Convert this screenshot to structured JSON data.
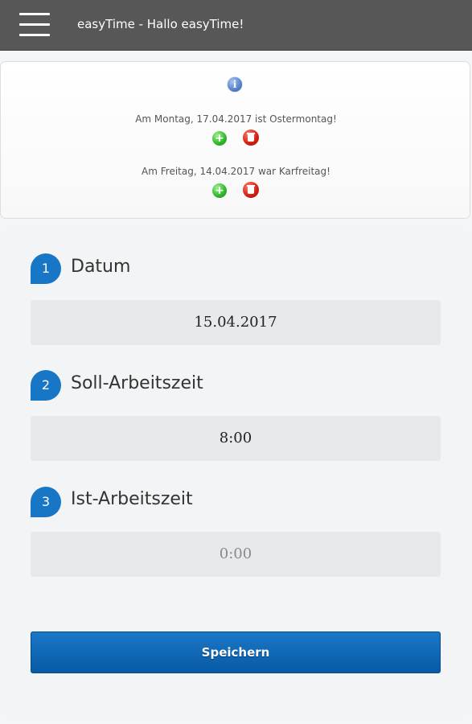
{
  "header": {
    "title": "easyTime - Hallo easyTime!",
    "menu_icon": "hamburger-menu-icon"
  },
  "info": {
    "icon": "info-icon",
    "icon_glyph": "i",
    "holidays": [
      {
        "text": "Am Montag, 17.04.2017 ist Ostermontag!"
      },
      {
        "text": "Am Freitag, 14.04.2017 war Karfreitag!"
      }
    ],
    "add_icon_glyph": "+"
  },
  "form": {
    "steps": [
      {
        "number": "1",
        "label": "Datum",
        "value": "15.04.2017"
      },
      {
        "number": "2",
        "label": "Soll-Arbeitszeit",
        "value": "8:00"
      },
      {
        "number": "3",
        "label": "Ist-Arbeitszeit",
        "placeholder": "0:00"
      }
    ],
    "save_label": "Speichern"
  },
  "colors": {
    "topbar": "#575757",
    "accent": "#1777c6",
    "add": "#2fb52a",
    "delete": "#d01f10"
  }
}
